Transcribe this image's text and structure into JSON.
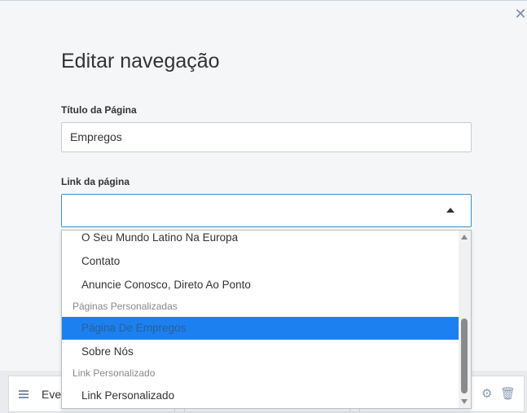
{
  "modal": {
    "title": "Editar navegação",
    "close_icon": "close-icon",
    "page_title_label": "Título da Página",
    "page_title_value": "Empregos",
    "page_link_label": "Link da página",
    "page_link_value": ""
  },
  "dropdown": {
    "items": [
      {
        "type": "option",
        "label": "O Seu Mundo Latino Na Europa"
      },
      {
        "type": "option",
        "label": "Contato"
      },
      {
        "type": "option",
        "label": "Anuncie Conosco, Direto Ao Ponto"
      },
      {
        "type": "group",
        "label": "Páginas Personalizadas"
      },
      {
        "type": "option",
        "label": "Página De Empregos",
        "selected": true
      },
      {
        "type": "option",
        "label": "Sobre Nós"
      },
      {
        "type": "group",
        "label": "Link Personalizado"
      },
      {
        "type": "option",
        "label": "Link Personalizado"
      }
    ]
  },
  "background_row": {
    "label": "Eve",
    "icons": [
      "menu-icon",
      "gear-icon",
      "trash-icon"
    ]
  },
  "colors": {
    "highlight": "#1c80f0",
    "focus_border": "#3a92c8"
  }
}
